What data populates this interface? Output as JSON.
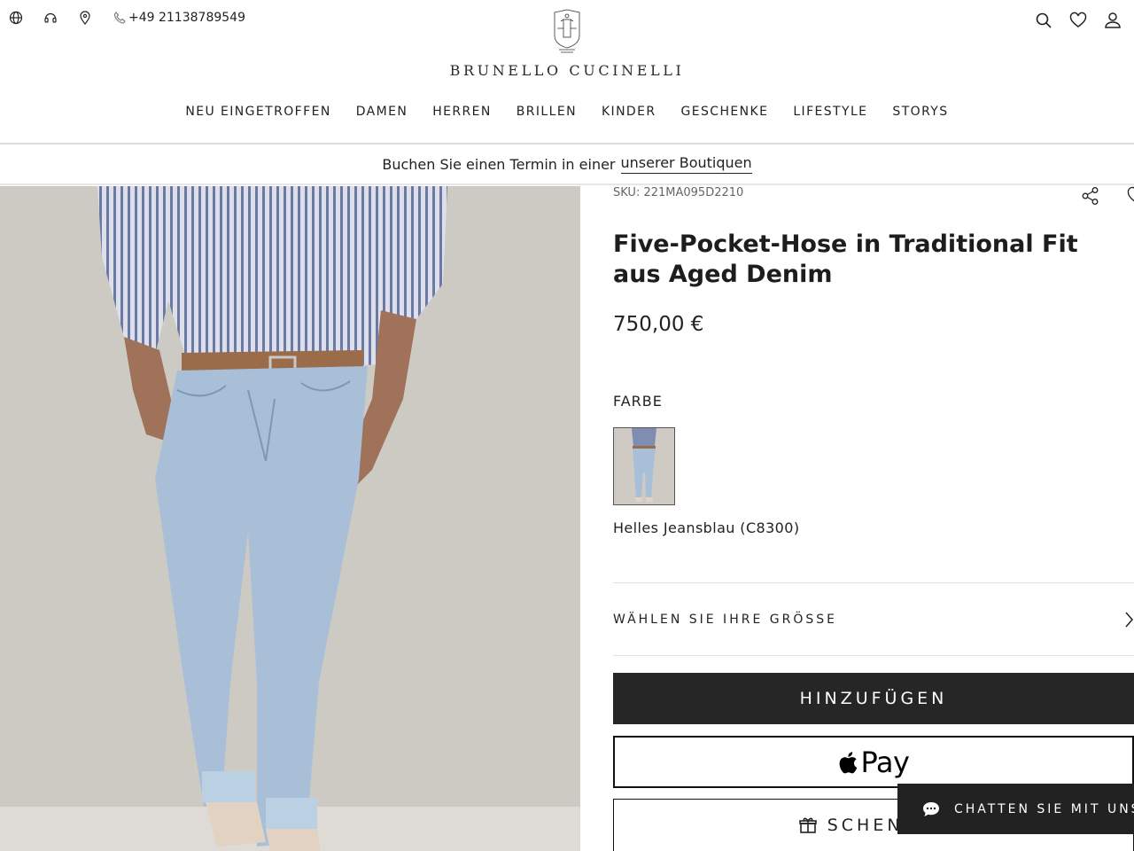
{
  "header": {
    "phone": "+49 21138789549",
    "brand": "BRUNELLO CUCINELLI",
    "icons_left": [
      "globe-icon",
      "headset-icon",
      "location-pin-icon",
      "phone-icon"
    ],
    "icons_right": [
      "search-icon",
      "heart-icon",
      "user-icon"
    ]
  },
  "nav": {
    "items": [
      "NEU EINGETROFFEN",
      "DAMEN",
      "HERREN",
      "BRILLEN",
      "KINDER",
      "GESCHENKE",
      "LIFESTYLE",
      "STORYS"
    ]
  },
  "banner": {
    "text": "Buchen Sie einen Termin in einer",
    "link": "unserer Boutiquen"
  },
  "product": {
    "sku": "SKU: 221MA095D2210",
    "title": "Five-Pocket-Hose in Traditional Fit aus Aged Denim",
    "price": "750,00 €",
    "color_heading": "FARBE",
    "color_name": "Helles Jeansblau (C8300)",
    "size_label": "WÄHLEN SIE IHRE GRÖSSE",
    "add_label": "HINZUFÜGEN",
    "apple_pay_label": "Pay",
    "gift_label": "SCHENKEN"
  },
  "chat": {
    "label": "CHATTEN SIE MIT UNS"
  },
  "colors": {
    "dark_button": "#262626",
    "background": "#ffffff",
    "divider": "#e0e0e0"
  }
}
